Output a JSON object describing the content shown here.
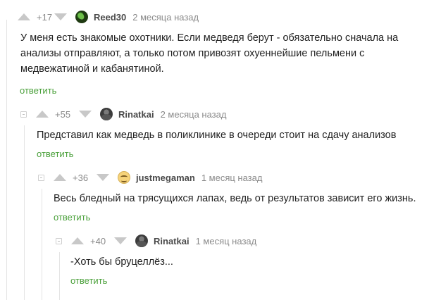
{
  "comments": [
    {
      "rating": "+17",
      "author": "Reed30",
      "time": "2 месяца назад",
      "text_lines": [
        "У меня есть знакомые охотники. Если медведя берут - обязательно сначала на",
        "анализы отправляют, а только потом привозят охуеннейшие пельмени с",
        "медвежатиной и кабанятиной."
      ],
      "reply": "ответить"
    },
    {
      "rating": "+55",
      "author": "Rinatkai",
      "time": "2 месяца назад",
      "text_lines": [
        "Представил как медведь в поликлинике в очереди стоит на сдачу анализов"
      ],
      "reply": "ответить"
    },
    {
      "rating": "+36",
      "author": "justmegaman",
      "time": "1 месяц назад",
      "text_lines": [
        "Весь бледный на трясущихся лапах, ведь от результатов зависит его жизнь."
      ],
      "reply": "ответить"
    },
    {
      "rating": "+40",
      "author": "Rinatkai",
      "time": "1 месяц назад",
      "text_lines": [
        "-Хоть бы бруцеллёз..."
      ],
      "reply": "ответить"
    }
  ],
  "colors": {
    "reply_link": "#4aa03a",
    "meta_gray": "#8a8a8a",
    "vote_arrow": "#c8c8c8",
    "thread_line": "#e4e4e4"
  },
  "icons": {
    "upvote": "upvote-arrow-icon",
    "downvote": "downvote-arrow-icon",
    "collapse": "collapse-thread-icon"
  }
}
